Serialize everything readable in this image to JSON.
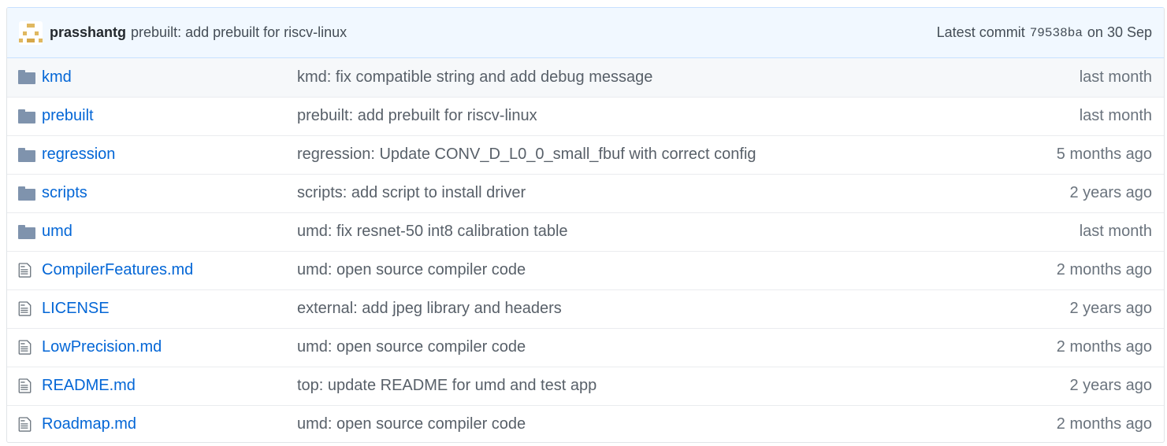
{
  "commit_tease": {
    "author": "prasshantg",
    "message": "prebuilt: add prebuilt for riscv-linux",
    "latest_label": "Latest commit",
    "sha": "79538ba",
    "date": "on 30 Sep"
  },
  "files": [
    {
      "type": "folder",
      "icon": "folder-icon",
      "name": "kmd",
      "message": "kmd: fix compatible string and add debug message",
      "age": "last month"
    },
    {
      "type": "folder",
      "icon": "folder-icon",
      "name": "prebuilt",
      "message": "prebuilt: add prebuilt for riscv-linux",
      "age": "last month"
    },
    {
      "type": "folder",
      "icon": "folder-icon",
      "name": "regression",
      "message": "regression: Update CONV_D_L0_0_small_fbuf with correct config",
      "age": "5 months ago"
    },
    {
      "type": "folder",
      "icon": "folder-icon",
      "name": "scripts",
      "message": "scripts: add script to install driver",
      "age": "2 years ago"
    },
    {
      "type": "folder",
      "icon": "folder-icon",
      "name": "umd",
      "message": "umd: fix resnet-50 int8 calibration table",
      "age": "last month"
    },
    {
      "type": "file",
      "icon": "file-text-icon",
      "name": "CompilerFeatures.md",
      "message": "umd: open source compiler code",
      "age": "2 months ago"
    },
    {
      "type": "file",
      "icon": "file-text-icon",
      "name": "LICENSE",
      "message": "external: add jpeg library and headers",
      "age": "2 years ago"
    },
    {
      "type": "file",
      "icon": "file-text-icon",
      "name": "LowPrecision.md",
      "message": "umd: open source compiler code",
      "age": "2 months ago"
    },
    {
      "type": "file",
      "icon": "file-text-icon",
      "name": "README.md",
      "message": "top: update README for umd and test app",
      "age": "2 years ago"
    },
    {
      "type": "file",
      "icon": "file-text-icon",
      "name": "Roadmap.md",
      "message": "umd: open source compiler code",
      "age": "2 months ago"
    }
  ],
  "colors": {
    "link": "#0366d6",
    "header_bg": "#f1f8ff",
    "folder_icon": "#7f93ad"
  }
}
